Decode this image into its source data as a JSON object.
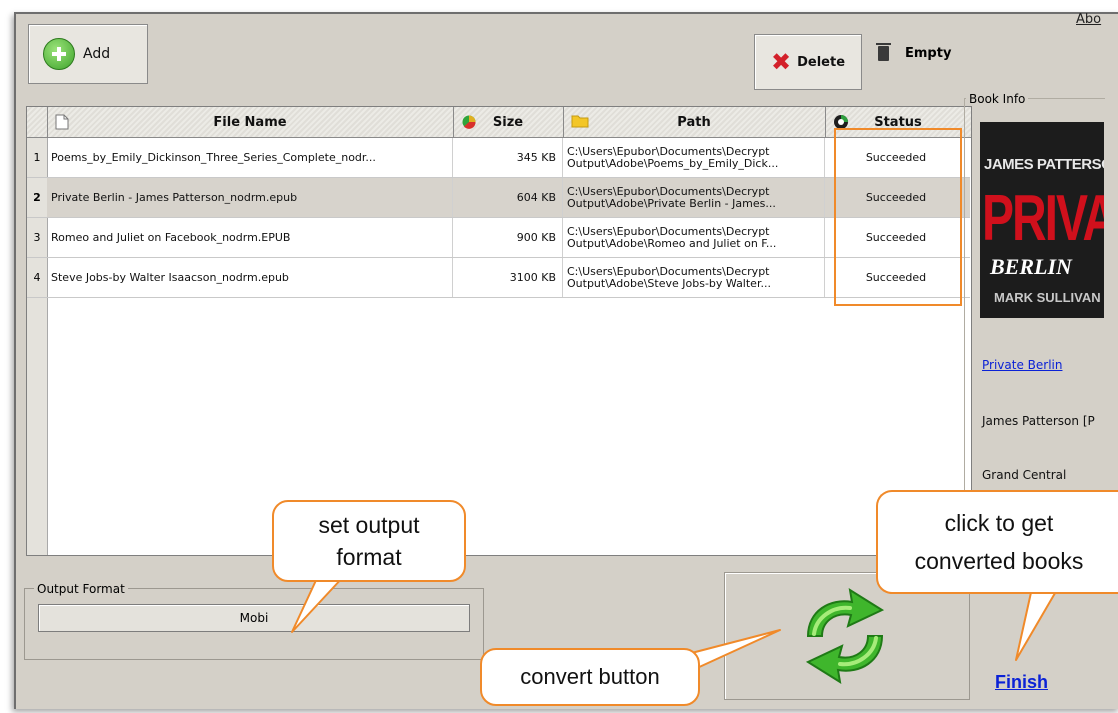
{
  "toolbar": {
    "add_label": "Add",
    "delete_label": "Delete",
    "empty_label": "Empty",
    "about_label": "Abo"
  },
  "table": {
    "columns": [
      "File Name",
      "Size",
      "Path",
      "Status"
    ],
    "rows": [
      {
        "num": "1",
        "file_name": "Poems_by_Emily_Dickinson_Three_Series_Complete_nodr...",
        "size": "345 KB",
        "path_line1": "C:\\Users\\Epubor\\Documents\\Decrypt",
        "path_line2": "Output\\Adobe\\Poems_by_Emily_Dick...",
        "status": "Succeeded"
      },
      {
        "num": "2",
        "file_name": "Private Berlin - James Patterson_nodrm.epub",
        "size": "604 KB",
        "path_line1": "C:\\Users\\Epubor\\Documents\\Decrypt",
        "path_line2": "Output\\Adobe\\Private Berlin - James...",
        "status": "Succeeded"
      },
      {
        "num": "3",
        "file_name": "Romeo and Juliet on Facebook_nodrm.EPUB",
        "size": "900 KB",
        "path_line1": "C:\\Users\\Epubor\\Documents\\Decrypt",
        "path_line2": "Output\\Adobe\\Romeo and Juliet on F...",
        "status": "Succeeded"
      },
      {
        "num": "4",
        "file_name": "Steve Jobs-by Walter Isaacson_nodrm.epub",
        "size": "3100 KB",
        "path_line1": "C:\\Users\\Epubor\\Documents\\Decrypt",
        "path_line2": "Output\\Adobe\\Steve Jobs-by Walter...",
        "status": "Succeeded"
      }
    ]
  },
  "book_info": {
    "title_label": "Book Info",
    "cover_author": "JAMES PATTERSON",
    "cover_title": "PRIVATE",
    "cover_subtitle": "BERLIN",
    "cover_coauthor": "MARK SULLIVAN",
    "title": "Private Berlin",
    "author": "James Patterson [P",
    "publisher": "Grand Central"
  },
  "output_format": {
    "label": "Output Format",
    "value": "Mobi"
  },
  "finish_label": "Finish",
  "callouts": {
    "format_line1": "set output",
    "format_line2": "format",
    "convert": "convert button",
    "get_line1": "click to get",
    "get_line2": "converted books"
  },
  "colors": {
    "highlight": "#f08a2a",
    "link": "#0b22d6",
    "window": "#d4d0c8"
  }
}
